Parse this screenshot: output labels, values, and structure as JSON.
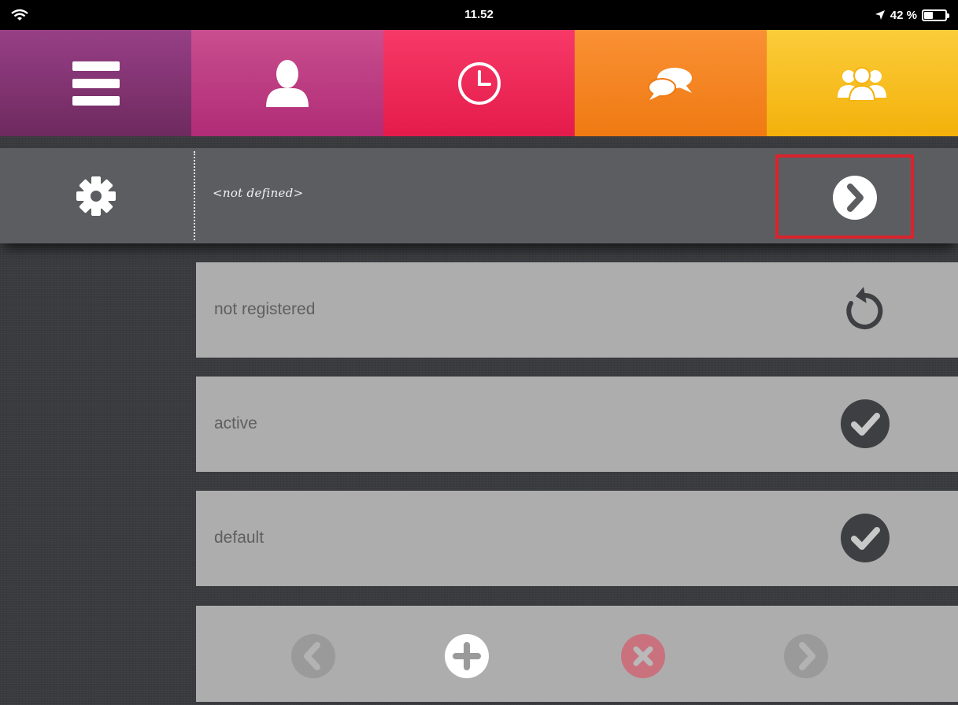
{
  "status_bar": {
    "time": "11.52",
    "battery": "42 %",
    "battery_level_fraction": 0.42
  },
  "tabs": [
    {
      "name": "menu",
      "icon": "menu-icon",
      "color_top": "#973f86",
      "color_bottom": "#6e2a5f"
    },
    {
      "name": "profile",
      "icon": "user-icon",
      "color_top": "#c94e8f",
      "color_bottom": "#b02c76"
    },
    {
      "name": "history",
      "icon": "clock-icon",
      "color_top": "#f73967",
      "color_bottom": "#e41b4b"
    },
    {
      "name": "chat",
      "icon": "chat-bubbles-icon",
      "color_top": "#f99034",
      "color_bottom": "#ef7a12"
    },
    {
      "name": "groups",
      "icon": "group-icon",
      "color_top": "#fbcc3a",
      "color_bottom": "#f3b10b"
    }
  ],
  "header": {
    "label": "<not defined>",
    "left_icon": "gear-icon",
    "right_icon": "chevron-right-icon",
    "highlight_color": "#d9232d"
  },
  "rows": [
    {
      "label": "not registered",
      "icon": "refresh-icon"
    },
    {
      "label": "active",
      "icon": "check-circle-icon"
    },
    {
      "label": "default",
      "icon": "check-circle-icon"
    }
  ],
  "toolbar": [
    {
      "name": "previous",
      "icon": "chevron-left-icon",
      "enabled": false
    },
    {
      "name": "add",
      "icon": "plus-circle-icon",
      "enabled": true
    },
    {
      "name": "delete",
      "icon": "close-circle-icon",
      "enabled": false
    },
    {
      "name": "next",
      "icon": "chevron-right-icon",
      "enabled": false
    }
  ]
}
